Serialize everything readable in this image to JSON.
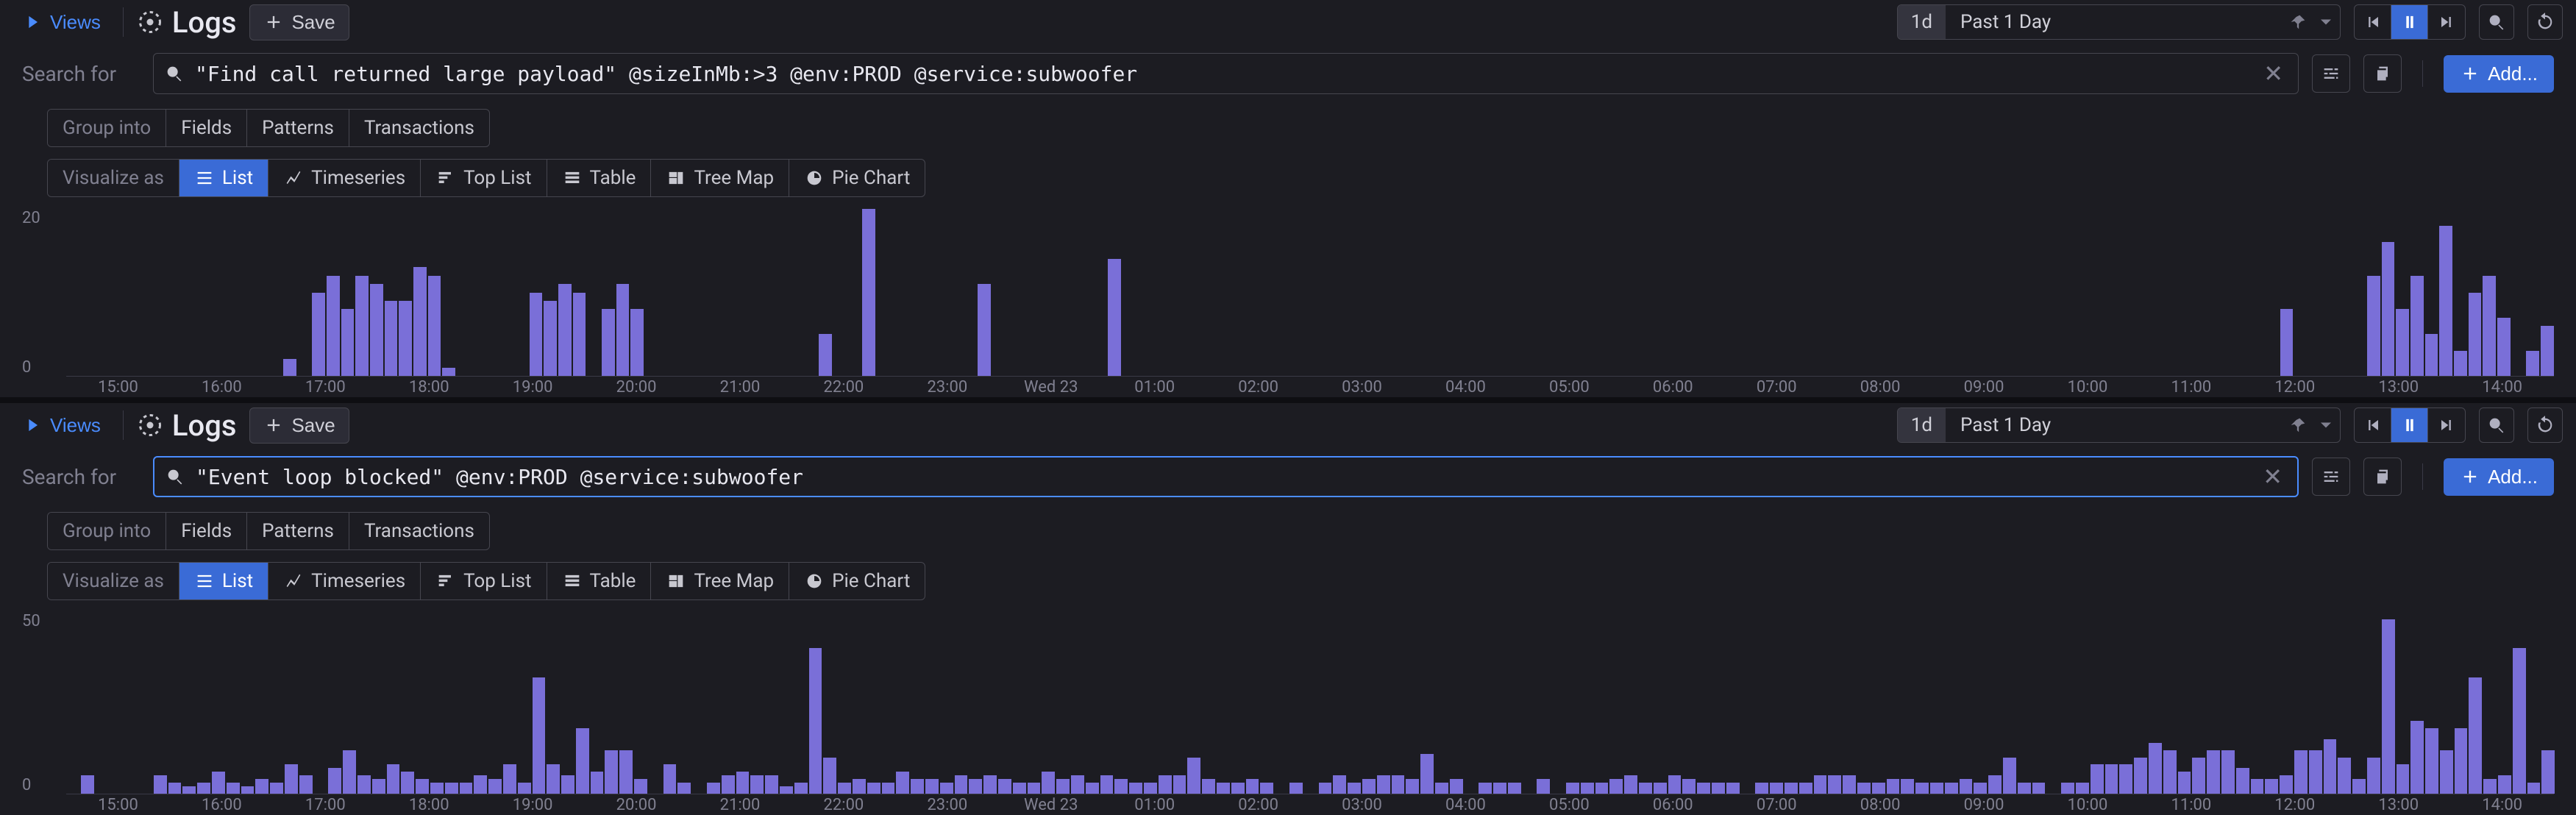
{
  "panels": [
    {
      "views_label": "Views",
      "title": "Logs",
      "save_label": "Save",
      "time_picker": {
        "short": "1d",
        "label": "Past 1 Day"
      },
      "search_label": "Search for",
      "search_query": "\"Find call returned large payload\" @sizeInMb:>3 @env:PROD @service:subwoofer",
      "search_focused": false,
      "add_label": "Add...",
      "group_into_label": "Group into",
      "group_tabs": [
        "Fields",
        "Patterns",
        "Transactions"
      ],
      "visualize_label": "Visualize as",
      "visualize_tabs": [
        "List",
        "Timeseries",
        "Top List",
        "Table",
        "Tree Map",
        "Pie Chart"
      ],
      "visualize_active": "List"
    },
    {
      "views_label": "Views",
      "title": "Logs",
      "save_label": "Save",
      "time_picker": {
        "short": "1d",
        "label": "Past 1 Day"
      },
      "search_label": "Search for",
      "search_query": "\"Event loop blocked\" @env:PROD @service:subwoofer",
      "search_focused": true,
      "add_label": "Add...",
      "group_into_label": "Group into",
      "group_tabs": [
        "Fields",
        "Patterns",
        "Transactions"
      ],
      "visualize_label": "Visualize as",
      "visualize_tabs": [
        "List",
        "Timeseries",
        "Top List",
        "Table",
        "Tree Map",
        "Pie Chart"
      ],
      "visualize_active": "List"
    }
  ],
  "xaxis_labels": [
    "15:00",
    "16:00",
    "17:00",
    "18:00",
    "19:00",
    "20:00",
    "21:00",
    "22:00",
    "23:00",
    "Wed 23",
    "01:00",
    "02:00",
    "03:00",
    "04:00",
    "05:00",
    "06:00",
    "07:00",
    "08:00",
    "09:00",
    "10:00",
    "11:00",
    "12:00",
    "13:00",
    "14:00"
  ],
  "chart_data": [
    {
      "type": "bar",
      "title": "",
      "xlabel": "",
      "ylabel": "",
      "y_ticks": [
        20,
        0
      ],
      "ylim": [
        0,
        20
      ],
      "categories": [
        "15:00",
        "16:00",
        "17:00",
        "18:00",
        "19:00",
        "20:00",
        "21:00",
        "22:00",
        "23:00",
        "Wed 23",
        "01:00",
        "02:00",
        "03:00",
        "04:00",
        "05:00",
        "06:00",
        "07:00",
        "08:00",
        "09:00",
        "10:00",
        "11:00",
        "12:00",
        "13:00",
        "14:00"
      ],
      "values": [
        0,
        0,
        0,
        0,
        0,
        0,
        0,
        0,
        0,
        0,
        0,
        0,
        0,
        0,
        0,
        2,
        0,
        10,
        12,
        8,
        12,
        11,
        9,
        9,
        13,
        12,
        1,
        0,
        0,
        0,
        0,
        0,
        10,
        9,
        11,
        10,
        0,
        8,
        11,
        8,
        0,
        0,
        0,
        0,
        0,
        0,
        0,
        0,
        0,
        0,
        0,
        0,
        5,
        0,
        0,
        20,
        0,
        0,
        0,
        0,
        0,
        0,
        0,
        11,
        0,
        0,
        0,
        0,
        0,
        0,
        0,
        0,
        14,
        0,
        0,
        0,
        0,
        0,
        0,
        0,
        0,
        0,
        0,
        0,
        0,
        0,
        0,
        0,
        0,
        0,
        0,
        0,
        0,
        0,
        0,
        0,
        0,
        0,
        0,
        0,
        0,
        0,
        0,
        0,
        0,
        0,
        0,
        0,
        0,
        0,
        0,
        0,
        0,
        0,
        0,
        0,
        0,
        0,
        0,
        0,
        0,
        0,
        0,
        0,
        0,
        0,
        0,
        0,
        0,
        0,
        0,
        0,
        0,
        0,
        0,
        0,
        0,
        0,
        0,
        0,
        0,
        0,
        0,
        0,
        0,
        0,
        0,
        0,
        0,
        0,
        0,
        0,
        0,
        8,
        0,
        0,
        0,
        0,
        0,
        12,
        16,
        8,
        12,
        5,
        18,
        3,
        10,
        12,
        7,
        0,
        3,
        6
      ]
    },
    {
      "type": "bar",
      "title": "",
      "xlabel": "",
      "ylabel": "",
      "y_ticks": [
        50,
        0
      ],
      "ylim": [
        0,
        50
      ],
      "categories": [
        "15:00",
        "16:00",
        "17:00",
        "18:00",
        "19:00",
        "20:00",
        "21:00",
        "22:00",
        "23:00",
        "Wed 23",
        "01:00",
        "02:00",
        "03:00",
        "04:00",
        "05:00",
        "06:00",
        "07:00",
        "08:00",
        "09:00",
        "10:00",
        "11:00",
        "12:00",
        "13:00",
        "14:00"
      ],
      "values": [
        0,
        5,
        0,
        0,
        0,
        0,
        5,
        3,
        2,
        3,
        6,
        3,
        2,
        4,
        3,
        8,
        5,
        0,
        7,
        12,
        5,
        4,
        8,
        6,
        4,
        3,
        3,
        3,
        5,
        4,
        8,
        3,
        32,
        8,
        5,
        18,
        6,
        12,
        12,
        4,
        0,
        8,
        3,
        0,
        3,
        5,
        6,
        5,
        5,
        2,
        3,
        40,
        10,
        3,
        4,
        3,
        3,
        6,
        4,
        4,
        3,
        5,
        4,
        5,
        4,
        3,
        3,
        6,
        4,
        5,
        3,
        5,
        4,
        3,
        3,
        5,
        5,
        10,
        4,
        3,
        3,
        4,
        3,
        0,
        3,
        0,
        3,
        5,
        3,
        4,
        5,
        5,
        4,
        11,
        3,
        4,
        0,
        3,
        3,
        3,
        0,
        4,
        0,
        3,
        3,
        3,
        4,
        5,
        3,
        3,
        5,
        4,
        3,
        3,
        3,
        0,
        3,
        3,
        3,
        3,
        5,
        5,
        5,
        3,
        3,
        4,
        4,
        3,
        3,
        3,
        4,
        3,
        5,
        10,
        3,
        3,
        0,
        3,
        3,
        8,
        8,
        8,
        10,
        14,
        12,
        6,
        10,
        12,
        12,
        7,
        4,
        4,
        5,
        12,
        12,
        15,
        10,
        4,
        10,
        48,
        8,
        20,
        18,
        12,
        18,
        32,
        4,
        5,
        40,
        3,
        12
      ]
    }
  ]
}
